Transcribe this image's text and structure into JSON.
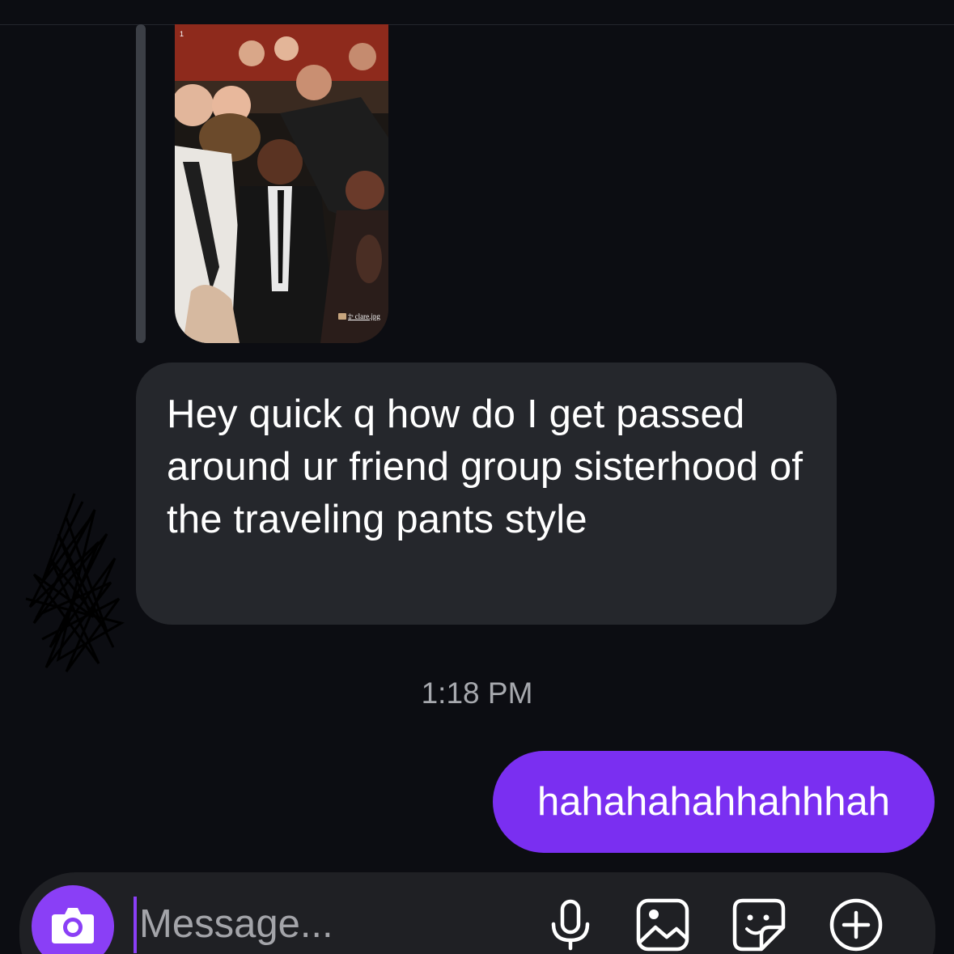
{
  "story": {
    "badge": "1",
    "caption": "‡ˢ clare.jpg"
  },
  "messages": {
    "received_text": "Hey quick q how do I get passed around ur friend group sisterhood of the traveling pants style",
    "timestamp": "1:18 PM",
    "sent_text": "hahahahahhahhhah"
  },
  "composer": {
    "placeholder": "Message...",
    "icons": [
      "camera-icon",
      "microphone-icon",
      "gallery-icon",
      "sticker-icon",
      "plus-icon"
    ]
  },
  "colors": {
    "background": "#0c0d12",
    "received_bubble": "#25272c",
    "sent_bubble": "#7a2ff1",
    "accent": "#8a3ff6",
    "timestamp": "#a7a9ae"
  }
}
